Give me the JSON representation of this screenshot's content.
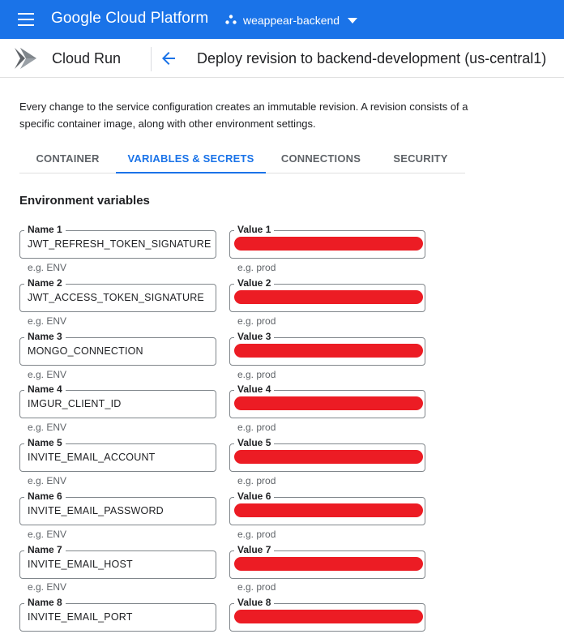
{
  "header": {
    "brand": "Google Cloud Platform",
    "project": "weappear-backend",
    "menu_icon": "hamburger-menu-icon",
    "brand_color": "#1a73e8"
  },
  "subheader": {
    "product": "Cloud Run",
    "title": "Deploy revision to backend-development (us-central1)"
  },
  "description": "Every change to the service configuration creates an immutable revision. A revision consists of a specific container image, along with other environment settings.",
  "tabs": [
    {
      "label": "CONTAINER",
      "active": false
    },
    {
      "label": "VARIABLES & SECRETS",
      "active": true
    },
    {
      "label": "CONNECTIONS",
      "active": false
    },
    {
      "label": "SECURITY",
      "active": false
    }
  ],
  "env": {
    "title": "Environment variables",
    "name_hint": "e.g. ENV",
    "value_hint": "e.g. prod",
    "rows": [
      {
        "name_label": "Name 1",
        "name": "JWT_REFRESH_TOKEN_SIGNATURE",
        "value_label": "Value 1"
      },
      {
        "name_label": "Name 2",
        "name": "JWT_ACCESS_TOKEN_SIGNATURE",
        "value_label": "Value 2"
      },
      {
        "name_label": "Name 3",
        "name": "MONGO_CONNECTION",
        "value_label": "Value 3"
      },
      {
        "name_label": "Name 4",
        "name": "IMGUR_CLIENT_ID",
        "value_label": "Value 4"
      },
      {
        "name_label": "Name 5",
        "name": "INVITE_EMAIL_ACCOUNT",
        "value_label": "Value 5"
      },
      {
        "name_label": "Name 6",
        "name": "INVITE_EMAIL_PASSWORD",
        "value_label": "Value 6"
      },
      {
        "name_label": "Name 7",
        "name": "INVITE_EMAIL_HOST",
        "value_label": "Value 7"
      },
      {
        "name_label": "Name 8",
        "name": "INVITE_EMAIL_PORT",
        "value_label": "Value 8"
      }
    ]
  }
}
